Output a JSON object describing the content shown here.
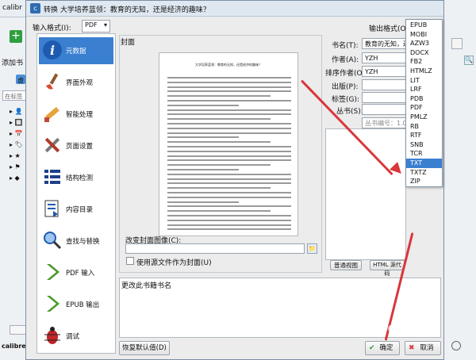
{
  "background": {
    "app_title": "calibr",
    "toolbar_label": "添加书",
    "search_hint": "在标签",
    "sidebar_letter": "虚",
    "status_text": "calibre 2"
  },
  "dialog": {
    "title": "转换 大学培养蓝领：教育的无知，还是经济的趣味？",
    "input_format_label": "输入格式(I):",
    "input_format_value": "PDF",
    "output_format_label": "输出格式(O):"
  },
  "nav": [
    {
      "label": "元数据",
      "icon": "info-icon",
      "selected": true
    },
    {
      "label": "界面外观",
      "icon": "brush-icon",
      "selected": false
    },
    {
      "label": "智能处理",
      "icon": "pencil-icon",
      "selected": false
    },
    {
      "label": "页面设置",
      "icon": "tools-icon",
      "selected": false
    },
    {
      "label": "结构检测",
      "icon": "list-icon",
      "selected": false
    },
    {
      "label": "内容目录",
      "icon": "toc-icon",
      "selected": false
    },
    {
      "label": "查找与替换",
      "icon": "magnifier-icon",
      "selected": false
    },
    {
      "label": "PDF 输入",
      "icon": "chevron-right-icon",
      "selected": false
    },
    {
      "label": "EPUB 输出",
      "icon": "chevron-right-icon",
      "selected": false
    },
    {
      "label": "调试",
      "icon": "bug-icon",
      "selected": false
    }
  ],
  "cover": {
    "group_label": "封面",
    "page_heading": "大学培养蓝领：教育的无知，还是经济的趣味？",
    "change_label": "改变封面图像(C):",
    "use_source_label": "使用源文件作为封面(U)"
  },
  "metadata": {
    "title_label": "书名(T):",
    "title_value": "教育的无知，还是经",
    "author_label": "作者(A):",
    "author_value": "YZH",
    "author_sort_label": "排序作者(O):",
    "author_sort_value": "YZH",
    "publisher_label": "出版(P):",
    "tags_label": "标签(G):",
    "series_label": "丛书(S):",
    "series_number": "丛书编号：1.00",
    "normal_view": "普通视图",
    "html_source": "HTML 源代码",
    "comment_label": "更改此书籍书名"
  },
  "formats": [
    "EPUB",
    "MOBI",
    "AZW3",
    "DOCX",
    "FB2",
    "HTMLZ",
    "LIT",
    "LRF",
    "PDB",
    "PDF",
    "PMLZ",
    "RB",
    "RTF",
    "SNB",
    "TCR",
    "TXT",
    "TXTZ",
    "ZIP"
  ],
  "selected_format": "TXT",
  "buttons": {
    "restore": "恢复默认值(D)",
    "ok": "确定",
    "cancel": "取消"
  },
  "watermark": "Baidu 经验",
  "colors": {
    "accent": "#3b7fd1",
    "arrow": "#d8373b"
  }
}
